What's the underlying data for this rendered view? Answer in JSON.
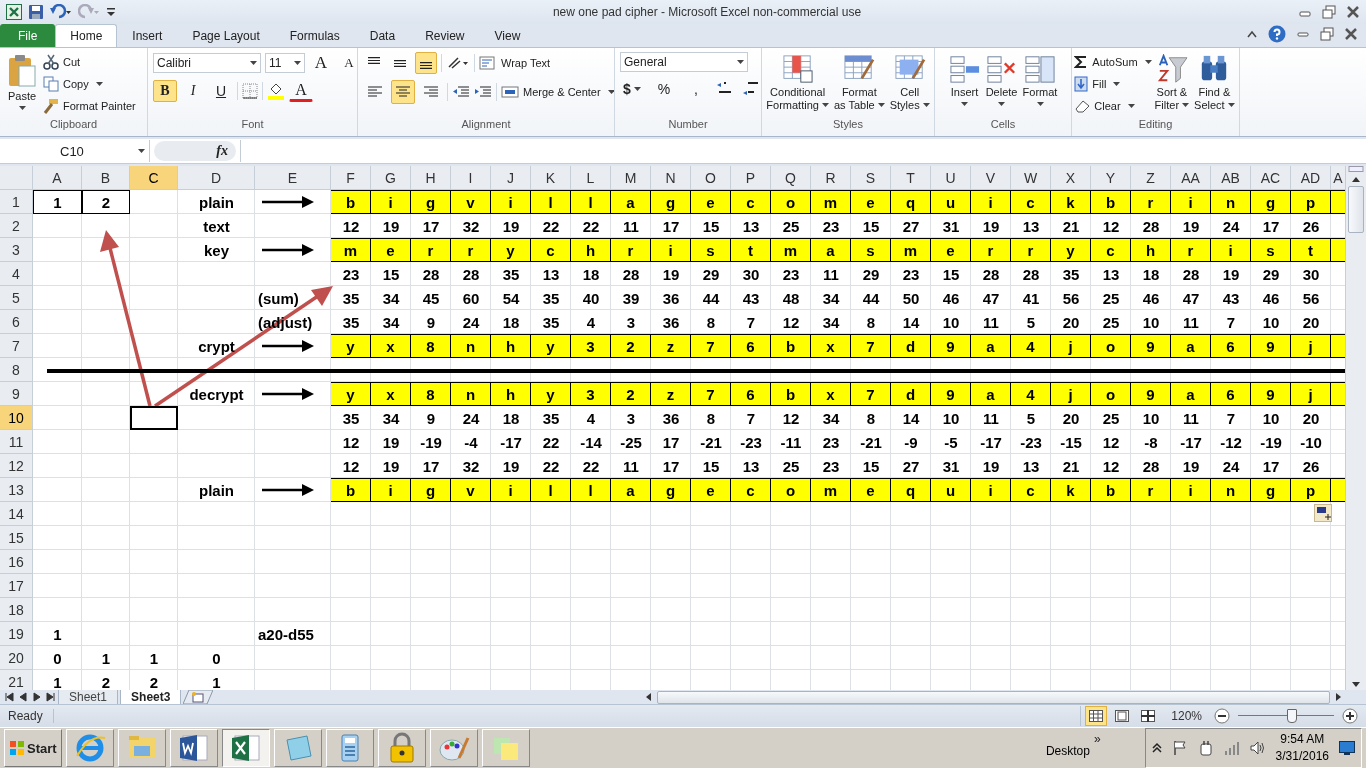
{
  "window": {
    "title": "new one pad cipher  -  Microsoft Excel non-commercial use"
  },
  "quick_access": [
    {
      "kind": "save"
    },
    {
      "kind": "undo"
    },
    {
      "kind": "redo"
    },
    {
      "kind": "customize"
    }
  ],
  "tabs": [
    {
      "label": "File",
      "kind": "file",
      "selected": false
    },
    {
      "label": "Home",
      "kind": "tab",
      "selected": true
    },
    {
      "label": "Insert",
      "kind": "tab",
      "selected": false
    },
    {
      "label": "Page Layout",
      "kind": "tab",
      "selected": false
    },
    {
      "label": "Formulas",
      "kind": "tab",
      "selected": false
    },
    {
      "label": "Data",
      "kind": "tab",
      "selected": false
    },
    {
      "label": "Review",
      "kind": "tab",
      "selected": false
    },
    {
      "label": "View",
      "kind": "tab",
      "selected": false
    }
  ],
  "ribbon": {
    "clipboard": {
      "title": "Clipboard",
      "paste": "Paste",
      "cut": "Cut",
      "copy": "Copy",
      "format_painter": "Format Painter"
    },
    "font": {
      "title": "Font",
      "family": "Calibri",
      "size": "11",
      "grow": "A",
      "shrink": "A",
      "font_color": "A",
      "styles": [
        {
          "label": "B",
          "kind": "bold",
          "selected": true
        },
        {
          "label": "I",
          "kind": "italic",
          "selected": false
        },
        {
          "label": "U",
          "kind": "underline",
          "selected": false
        }
      ]
    },
    "alignment": {
      "title": "Alignment",
      "wrap": "Wrap Text",
      "merge": "Merge & Center",
      "vertical": [
        {
          "kind": "top",
          "selected": false
        },
        {
          "kind": "middle",
          "selected": false
        },
        {
          "kind": "bottom",
          "selected": true
        }
      ],
      "horizontal": [
        {
          "kind": "left",
          "selected": false
        },
        {
          "kind": "center",
          "selected": true
        },
        {
          "kind": "right",
          "selected": false
        }
      ]
    },
    "number": {
      "title": "Number",
      "format": "General",
      "currency": "$",
      "percent": "%",
      "comma": ","
    },
    "styles": {
      "title": "Styles",
      "buttons": [
        {
          "lines": [
            "Conditional",
            "Formatting"
          ],
          "kind": "conditional"
        },
        {
          "lines": [
            "Format",
            "as Table"
          ],
          "kind": "table"
        },
        {
          "lines": [
            "Cell",
            "Styles"
          ],
          "kind": "cellstyles"
        }
      ]
    },
    "cells": {
      "title": "Cells",
      "buttons": [
        {
          "label": "Insert",
          "kind": "insert"
        },
        {
          "label": "Delete",
          "kind": "delete"
        },
        {
          "label": "Format",
          "kind": "format"
        }
      ]
    },
    "editing": {
      "title": "Editing",
      "small": [
        {
          "label": "AutoSum",
          "kind": "autosum"
        },
        {
          "label": "Fill",
          "kind": "fill"
        },
        {
          "label": "Clear",
          "kind": "clear"
        }
      ],
      "large": [
        {
          "lines": [
            "Sort &",
            "Filter"
          ],
          "kind": "sort"
        },
        {
          "lines": [
            "Find &",
            "Select"
          ],
          "kind": "find"
        }
      ]
    }
  },
  "formula_bar": {
    "name_box": "C10",
    "function_label": "fx"
  },
  "sheet": {
    "columns": [
      {
        "label": "A",
        "selected": false
      },
      {
        "label": "B",
        "selected": false
      },
      {
        "label": "C",
        "selected": true
      },
      {
        "label": "D",
        "selected": false
      },
      {
        "label": "E",
        "selected": false
      },
      {
        "label": "F",
        "selected": false
      },
      {
        "label": "G",
        "selected": false
      },
      {
        "label": "H",
        "selected": false
      },
      {
        "label": "I",
        "selected": false
      },
      {
        "label": "J",
        "selected": false
      },
      {
        "label": "K",
        "selected": false
      },
      {
        "label": "L",
        "selected": false
      },
      {
        "label": "M",
        "selected": false
      },
      {
        "label": "N",
        "selected": false
      },
      {
        "label": "O",
        "selected": false
      },
      {
        "label": "P",
        "selected": false
      },
      {
        "label": "Q",
        "selected": false
      },
      {
        "label": "R",
        "selected": false
      },
      {
        "label": "S",
        "selected": false
      },
      {
        "label": "T",
        "selected": false
      },
      {
        "label": "U",
        "selected": false
      },
      {
        "label": "V",
        "selected": false
      },
      {
        "label": "W",
        "selected": false
      },
      {
        "label": "X",
        "selected": false
      },
      {
        "label": "Y",
        "selected": false
      },
      {
        "label": "Z",
        "selected": false
      },
      {
        "label": "AA",
        "selected": false
      },
      {
        "label": "AB",
        "selected": false
      },
      {
        "label": "AC",
        "selected": false
      },
      {
        "label": "AD",
        "selected": false
      },
      {
        "label": "A",
        "selected": false
      }
    ],
    "rows": [
      {
        "number": "1",
        "selected": false,
        "highlight": true,
        "arrow": true,
        "cells": [
          {
            "text": "1",
            "boxed": true
          },
          {
            "text": "2",
            "boxed": true
          },
          null,
          "plain",
          null,
          "b",
          "i",
          "g",
          "v",
          "i",
          "l",
          "l",
          "a",
          "g",
          "e",
          "c",
          "o",
          "m",
          "e",
          "q",
          "u",
          "i",
          "c",
          "k",
          "b",
          "r",
          "i",
          "n",
          "g",
          "p"
        ]
      },
      {
        "number": "2",
        "selected": false,
        "cells": [
          null,
          null,
          null,
          "text",
          null,
          "12",
          "19",
          "17",
          "32",
          "19",
          "22",
          "22",
          "11",
          "17",
          "15",
          "13",
          "25",
          "23",
          "15",
          "27",
          "31",
          "19",
          "13",
          "21",
          "12",
          "28",
          "19",
          "24",
          "17",
          "26"
        ]
      },
      {
        "number": "3",
        "selected": false,
        "highlight": true,
        "arrow": true,
        "cells": [
          null,
          null,
          null,
          "key",
          null,
          "m",
          "e",
          "r",
          "r",
          "y",
          "c",
          "h",
          "r",
          "i",
          "s",
          "t",
          "m",
          "a",
          "s",
          "m",
          "e",
          "r",
          "r",
          "y",
          "c",
          "h",
          "r",
          "i",
          "s",
          "t"
        ]
      },
      {
        "number": "4",
        "selected": false,
        "cells": [
          null,
          null,
          null,
          null,
          null,
          "23",
          "15",
          "28",
          "28",
          "35",
          "13",
          "18",
          "28",
          "19",
          "29",
          "30",
          "23",
          "11",
          "29",
          "23",
          "15",
          "28",
          "28",
          "35",
          "13",
          "18",
          "28",
          "19",
          "29",
          "30"
        ]
      },
      {
        "number": "5",
        "selected": false,
        "cells": [
          null,
          null,
          null,
          null,
          "(sum)",
          "35",
          "34",
          "45",
          "60",
          "54",
          "35",
          "40",
          "39",
          "36",
          "44",
          "43",
          "48",
          "34",
          "44",
          "50",
          "46",
          "47",
          "41",
          "56",
          "25",
          "46",
          "47",
          "43",
          "46",
          "56"
        ]
      },
      {
        "number": "6",
        "selected": false,
        "cells": [
          null,
          null,
          null,
          null,
          "(adjust)",
          "35",
          "34",
          "9",
          "24",
          "18",
          "35",
          "4",
          "3",
          "36",
          "8",
          "7",
          "12",
          "34",
          "8",
          "14",
          "10",
          "11",
          "5",
          "20",
          "25",
          "10",
          "11",
          "7",
          "10",
          "20"
        ]
      },
      {
        "number": "7",
        "selected": false,
        "highlight": true,
        "arrow": true,
        "cells": [
          null,
          null,
          null,
          "crypt",
          null,
          "y",
          "x",
          "8",
          "n",
          "h",
          "y",
          "3",
          "2",
          "z",
          "7",
          "6",
          "b",
          "x",
          "7",
          "d",
          "9",
          "a",
          "4",
          "j",
          "o",
          "9",
          "a",
          "6",
          "9",
          "j"
        ]
      },
      {
        "number": "8",
        "selected": false,
        "rule": true,
        "cells": []
      },
      {
        "number": "9",
        "selected": false,
        "highlight": true,
        "arrow": true,
        "cells": [
          null,
          null,
          null,
          "decrypt",
          null,
          "y",
          "x",
          "8",
          "n",
          "h",
          "y",
          "3",
          "2",
          "z",
          "7",
          "6",
          "b",
          "x",
          "7",
          "d",
          "9",
          "a",
          "4",
          "j",
          "o",
          "9",
          "a",
          "6",
          "9",
          "j"
        ]
      },
      {
        "number": "10",
        "selected": true,
        "cells": [
          null,
          null,
          null,
          null,
          null,
          "35",
          "34",
          "9",
          "24",
          "18",
          "35",
          "4",
          "3",
          "36",
          "8",
          "7",
          "12",
          "34",
          "8",
          "14",
          "10",
          "11",
          "5",
          "20",
          "25",
          "10",
          "11",
          "7",
          "10",
          "20"
        ]
      },
      {
        "number": "11",
        "selected": false,
        "cells": [
          null,
          null,
          null,
          null,
          null,
          "12",
          "19",
          "-19",
          "-4",
          "-17",
          "22",
          "-14",
          "-25",
          "17",
          "-21",
          "-23",
          "-11",
          "23",
          "-21",
          "-9",
          "-5",
          "-17",
          "-23",
          "-15",
          "12",
          "-8",
          "-17",
          "-12",
          "-19",
          "-10"
        ]
      },
      {
        "number": "12",
        "selected": false,
        "cells": [
          null,
          null,
          null,
          null,
          null,
          "12",
          "19",
          "17",
          "32",
          "19",
          "22",
          "22",
          "11",
          "17",
          "15",
          "13",
          "25",
          "23",
          "15",
          "27",
          "31",
          "19",
          "13",
          "21",
          "12",
          "28",
          "19",
          "24",
          "17",
          "26"
        ]
      },
      {
        "number": "13",
        "selected": false,
        "highlight": true,
        "arrow": true,
        "cells": [
          null,
          null,
          null,
          "plain",
          null,
          "b",
          "i",
          "g",
          "v",
          "i",
          "l",
          "l",
          "a",
          "g",
          "e",
          "c",
          "o",
          "m",
          "e",
          "q",
          "u",
          "i",
          "c",
          "k",
          "b",
          "r",
          "i",
          "n",
          "g",
          "p"
        ]
      },
      {
        "number": "14",
        "selected": false,
        "cells": []
      },
      {
        "number": "15",
        "selected": false,
        "cells": []
      },
      {
        "number": "16",
        "selected": false,
        "cells": []
      },
      {
        "number": "17",
        "selected": false,
        "cells": []
      },
      {
        "number": "18",
        "selected": false,
        "cells": []
      },
      {
        "number": "19",
        "selected": false,
        "cells": [
          "1",
          null,
          null,
          null,
          "a20-d55"
        ]
      },
      {
        "number": "20",
        "selected": false,
        "cells": [
          "0",
          "1",
          "1",
          "0"
        ]
      },
      {
        "number": "21",
        "selected": false,
        "cells": [
          "1",
          "2",
          "2",
          "1"
        ]
      }
    ]
  },
  "sheet_tabs": [
    {
      "label": "Sheet1",
      "selected": false
    },
    {
      "label": "Sheet3",
      "selected": true
    }
  ],
  "status_bar": {
    "text": "Ready",
    "zoom": "120%",
    "zoom_slider": {
      "level": 0.55
    },
    "views": [
      {
        "kind": "normal",
        "selected": true
      },
      {
        "kind": "layout",
        "selected": false
      },
      {
        "kind": "pagebreak",
        "selected": false
      }
    ]
  },
  "taskbar": {
    "start": "Start",
    "desktop": "Desktop",
    "more": "»",
    "time": "9:54 AM",
    "date": "3/31/2016",
    "apps": [
      {
        "kind": "browser",
        "selected": false
      },
      {
        "kind": "folder",
        "selected": false
      },
      {
        "kind": "word",
        "selected": false
      },
      {
        "kind": "excel",
        "selected": true
      },
      {
        "kind": "notepad",
        "selected": false
      },
      {
        "kind": "calculator",
        "selected": false
      },
      {
        "kind": "lock",
        "selected": false
      },
      {
        "kind": "paint",
        "selected": false
      },
      {
        "kind": "notes",
        "selected": false
      }
    ]
  }
}
